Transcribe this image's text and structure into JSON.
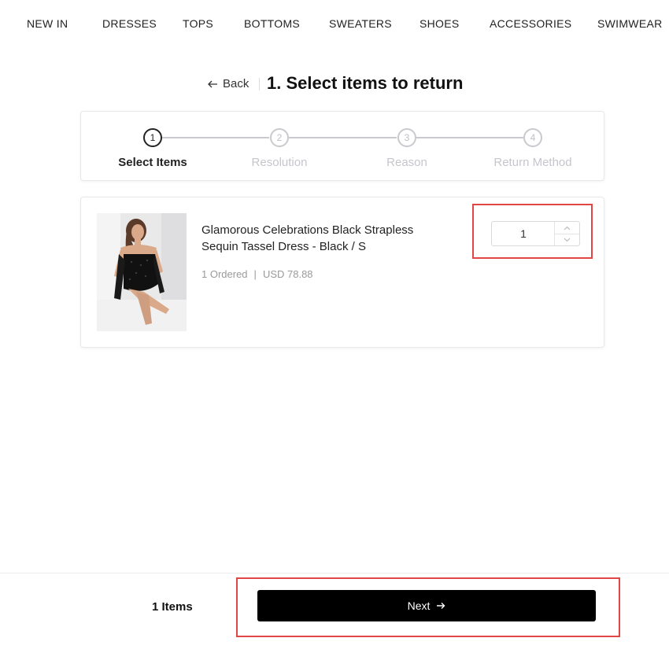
{
  "nav": {
    "items": [
      "NEW IN",
      "DRESSES",
      "TOPS",
      "BOTTOMS",
      "SWEATERS",
      "SHOES",
      "ACCESSORIES",
      "SWIMWEAR"
    ]
  },
  "header": {
    "back_label": "Back",
    "title": "1. Select items to return"
  },
  "stepper": {
    "steps": [
      {
        "number": "1",
        "label": "Select Items"
      },
      {
        "number": "2",
        "label": "Resolution"
      },
      {
        "number": "3",
        "label": "Reason"
      },
      {
        "number": "4",
        "label": "Return Method"
      }
    ],
    "active_index": 0
  },
  "item": {
    "name": "Glamorous Celebrations Black Strapless Sequin Tassel Dress - Black / S",
    "ordered": "1 Ordered",
    "separator": "|",
    "price": "USD 78.88",
    "quantity": "1"
  },
  "footer": {
    "items_count": "1 Items",
    "next_label": "Next"
  },
  "colors": {
    "highlight": "#e04646",
    "button_bg": "#000000",
    "inactive_step": "#c9c9ce"
  }
}
